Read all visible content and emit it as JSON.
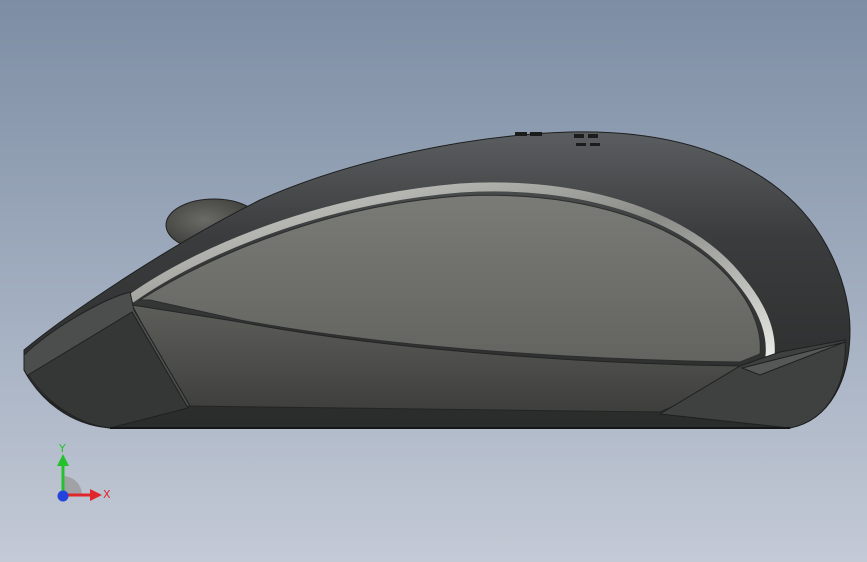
{
  "viewport": {
    "colors": {
      "background_top": "#7d8da3",
      "background_bottom": "#c4cad6",
      "model_shell": "#3c3e3f",
      "model_side_panel": "#6e6f6a"
    }
  },
  "model": {
    "icon": "computer-mouse-3d-model"
  },
  "triad": {
    "icon": "coordinate-axes-triad-icon",
    "y_label": "Y",
    "x_label": "X",
    "colors": {
      "x": "#e0262a",
      "y": "#25c12d",
      "z": "#2244dd"
    }
  }
}
